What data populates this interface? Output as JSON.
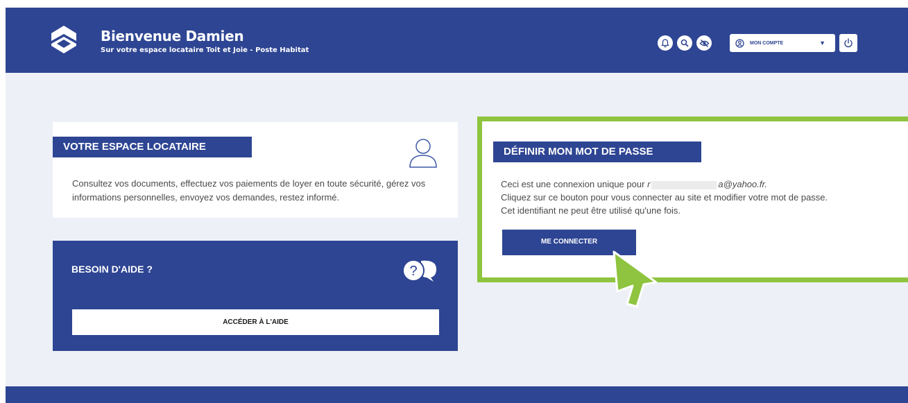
{
  "header": {
    "title": "Bienvenue Damien",
    "subtitle": "Sur votre espace locataire Toit et Joie - Poste Habitat",
    "icons": [
      "bell-icon",
      "search-icon",
      "eye-off-icon"
    ],
    "account_label": "MON COMPTE",
    "brand_color": "#2e4593"
  },
  "tenant_card": {
    "title": "VOTRE ESPACE LOCATAIRE",
    "text": "Consultez vos documents, effectuez vos paiements de loyer en toute sécurité, gérez vos informations personnelles, envoyez vos demandes, restez informé."
  },
  "help_card": {
    "title": "BESOIN D'AIDE ?",
    "button": "ACCÉDER À L'AIDE"
  },
  "password_card": {
    "title": "DÉFINIR MON MOT DE PASSE",
    "line1_prefix": "Ceci est une connexion unique pour",
    "email_start": "r",
    "email_end": "a@yahoo.fr.",
    "line2": "Cliquez sur ce bouton pour vous connecter au site et modifier votre mot de passe.",
    "line3": "Cet identifiant ne peut être utilisé qu'une fois.",
    "button": "ME CONNECTER",
    "highlight_color": "#8ec43f"
  }
}
